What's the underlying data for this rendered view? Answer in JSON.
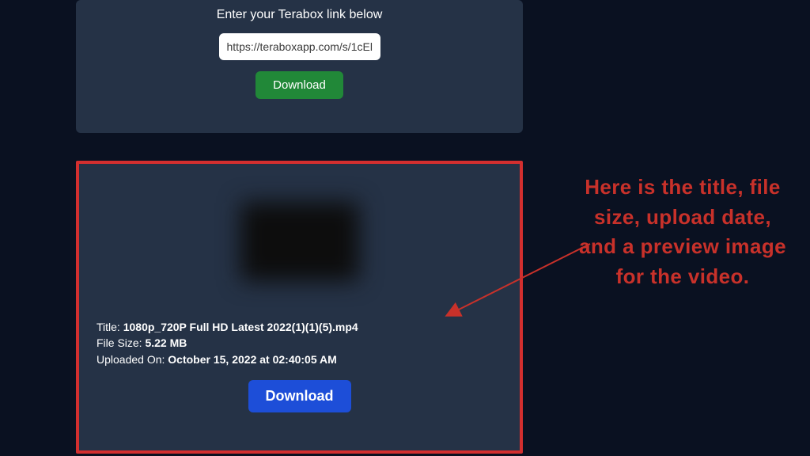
{
  "input_card": {
    "title": "Enter your Terabox link below",
    "url_value": "https://teraboxapp.com/s/1cEl",
    "download_label": "Download"
  },
  "result": {
    "title_label": "Title: ",
    "title_value": "1080p_720P Full HD Latest 2022(1)(1)(5).mp4",
    "size_label": "File Size: ",
    "size_value": "5.22 MB",
    "uploaded_label": "Uploaded On: ",
    "uploaded_value": "October 15, 2022 at 02:40:05 AM",
    "download_label": "Download"
  },
  "annotation": {
    "text": "Here is  the title, file size, upload date, and a preview image for the video."
  },
  "colors": {
    "bg": "#0a1121",
    "card": "#253246",
    "green": "#218838",
    "blue": "#1d4ed8",
    "red": "#c8312a"
  }
}
